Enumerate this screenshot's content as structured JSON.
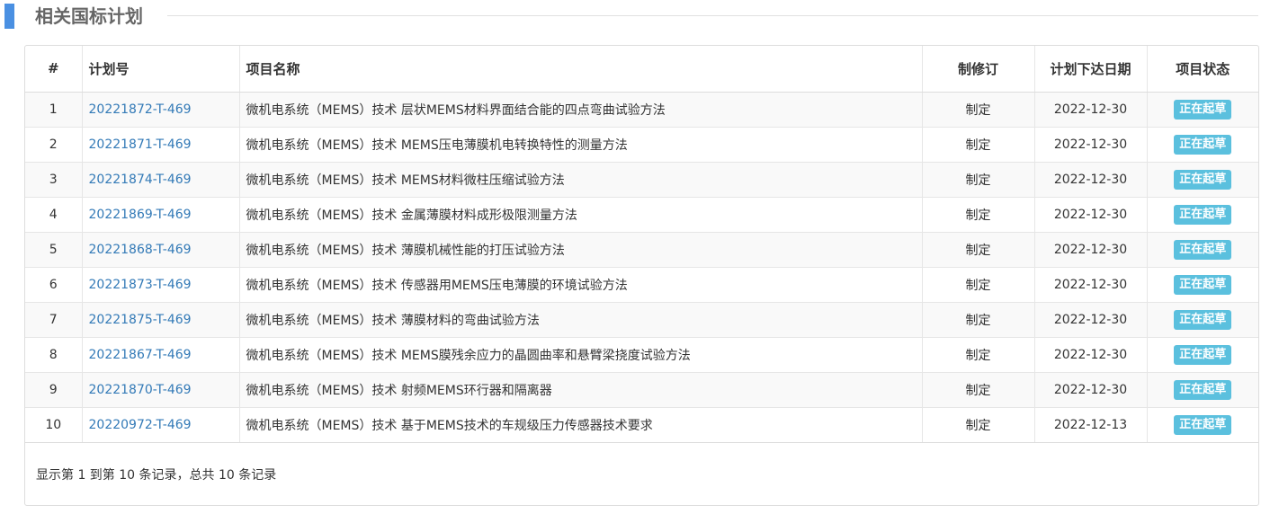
{
  "section": {
    "title": "相关国标计划",
    "accent_color": "#4a90e2"
  },
  "table": {
    "headers": {
      "index": "#",
      "code": "计划号",
      "name": "项目名称",
      "type": "制修订",
      "date": "计划下达日期",
      "status": "项目状态"
    },
    "rows": [
      {
        "index": "1",
        "code": "20221872-T-469",
        "name": "微机电系统（MEMS）技术 层状MEMS材料界面结合能的四点弯曲试验方法",
        "type": "制定",
        "date": "2022-12-30",
        "status": "正在起草"
      },
      {
        "index": "2",
        "code": "20221871-T-469",
        "name": "微机电系统（MEMS）技术 MEMS压电薄膜机电转换特性的测量方法",
        "type": "制定",
        "date": "2022-12-30",
        "status": "正在起草"
      },
      {
        "index": "3",
        "code": "20221874-T-469",
        "name": "微机电系统（MEMS）技术 MEMS材料微柱压缩试验方法",
        "type": "制定",
        "date": "2022-12-30",
        "status": "正在起草"
      },
      {
        "index": "4",
        "code": "20221869-T-469",
        "name": "微机电系统（MEMS）技术 金属薄膜材料成形极限测量方法",
        "type": "制定",
        "date": "2022-12-30",
        "status": "正在起草"
      },
      {
        "index": "5",
        "code": "20221868-T-469",
        "name": "微机电系统（MEMS）技术 薄膜机械性能的打压试验方法",
        "type": "制定",
        "date": "2022-12-30",
        "status": "正在起草"
      },
      {
        "index": "6",
        "code": "20221873-T-469",
        "name": "微机电系统（MEMS）技术 传感器用MEMS压电薄膜的环境试验方法",
        "type": "制定",
        "date": "2022-12-30",
        "status": "正在起草"
      },
      {
        "index": "7",
        "code": "20221875-T-469",
        "name": "微机电系统（MEMS）技术 薄膜材料的弯曲试验方法",
        "type": "制定",
        "date": "2022-12-30",
        "status": "正在起草"
      },
      {
        "index": "8",
        "code": "20221867-T-469",
        "name": "微机电系统（MEMS）技术 MEMS膜残余应力的晶圆曲率和悬臂梁挠度试验方法",
        "type": "制定",
        "date": "2022-12-30",
        "status": "正在起草"
      },
      {
        "index": "9",
        "code": "20221870-T-469",
        "name": "微机电系统（MEMS）技术 射频MEMS环行器和隔离器",
        "type": "制定",
        "date": "2022-12-30",
        "status": "正在起草"
      },
      {
        "index": "10",
        "code": "20220972-T-469",
        "name": "微机电系统（MEMS）技术 基于MEMS技术的车规级压力传感器技术要求",
        "type": "制定",
        "date": "2022-12-13",
        "status": "正在起草"
      }
    ],
    "link_color": "#337ab7",
    "badge_color": "#5bc0de"
  },
  "pagination": {
    "info": "显示第 1 到第 10 条记录，总共 10 条记录"
  }
}
